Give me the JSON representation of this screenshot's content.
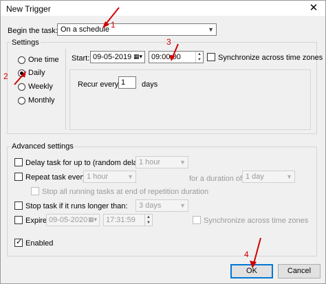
{
  "window": {
    "title": "New Trigger",
    "close_glyph": "✕"
  },
  "begin": {
    "label": "Begin the task:",
    "value": "On a schedule"
  },
  "settings": {
    "title": "Settings",
    "radios": [
      {
        "label": "One time",
        "selected": false
      },
      {
        "label": "Daily",
        "selected": true
      },
      {
        "label": "Weekly",
        "selected": false
      },
      {
        "label": "Monthly",
        "selected": false
      }
    ],
    "start_label": "Start:",
    "start_date": "09-05-2019",
    "start_time": "09:00:00",
    "sync_label": "Synchronize across time zones",
    "recur_label": "Recur every:",
    "recur_value": "1",
    "recur_unit": "days"
  },
  "advanced": {
    "title": "Advanced settings",
    "delay_label": "Delay task for up to (random delay):",
    "delay_value": "1 hour",
    "repeat_label": "Repeat task every:",
    "repeat_value": "1 hour",
    "duration_label": "for a duration of:",
    "duration_value": "1 day",
    "stop_all_label": "Stop all running tasks at end of repetition duration",
    "stop_label": "Stop task if it runs longer than:",
    "stop_value": "3 days",
    "expire_label": "Expire:",
    "expire_date": "09-05-2020",
    "expire_time": "17:31:59",
    "expire_sync_label": "Synchronize across time zones",
    "enabled_label": "Enabled"
  },
  "buttons": {
    "ok": "OK",
    "cancel": "Cancel"
  },
  "annotations": [
    "1",
    "2",
    "3",
    "4"
  ],
  "annotation_color": "#d10000"
}
